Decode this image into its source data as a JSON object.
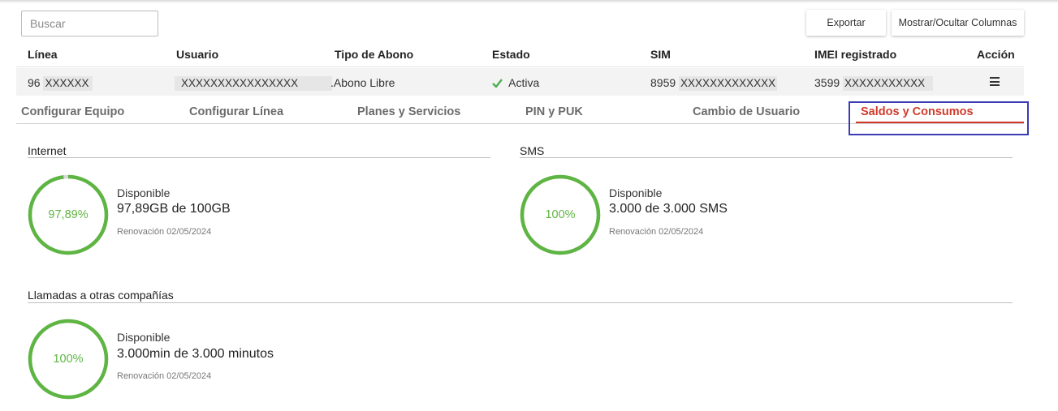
{
  "search": {
    "placeholder": "Buscar"
  },
  "toolbar": {
    "export_label": "Exportar",
    "columns_label": "Mostrar/Ocultar Columnas"
  },
  "table": {
    "headers": [
      "Línea",
      "Usuario",
      "Tipo de Abono",
      "Estado",
      "SIM",
      "IMEI registrado",
      "Acción"
    ],
    "row": {
      "line_prefix": "96",
      "line_masked": "XXXXXX",
      "user_masked": "XXXXXXXXXXXXXXXX",
      "plan": ".Abono Libre",
      "status": "Activa",
      "sim_prefix": "8959",
      "sim_masked": "XXXXXXXXXXXXX",
      "imei_prefix": "3599",
      "imei_masked": "XXXXXXXXXXX"
    }
  },
  "tabs": [
    {
      "label": "Configurar Equipo",
      "active": false
    },
    {
      "label": "Configurar Línea",
      "active": false
    },
    {
      "label": "Planes y Servicios",
      "active": false
    },
    {
      "label": "PIN y PUK",
      "active": false
    },
    {
      "label": "Cambio de Usuario",
      "active": false
    },
    {
      "label": "Saldos y Consumos",
      "active": true
    }
  ],
  "balances": [
    {
      "title": "Internet",
      "percent_label": "97,89%",
      "percent": 97.89,
      "available_label": "Disponible",
      "amount": "97,89GB de 100GB",
      "renewal": "Renovación 02/05/2024"
    },
    {
      "title": "SMS",
      "percent_label": "100%",
      "percent": 100,
      "available_label": "Disponible",
      "amount": "3.000 de 3.000 SMS",
      "renewal": "Renovación 02/05/2024"
    },
    {
      "title": "Llamadas a otras compañías",
      "percent_label": "100%",
      "percent": 100,
      "available_label": "Disponible",
      "amount": "3.000min de 3.000 minutos",
      "renewal": "Renovación 02/05/2024"
    }
  ],
  "colors": {
    "accent": "#d03a2b",
    "gauge": "#5fb543",
    "gauge_track": "#d9d9d9",
    "status_ok": "#4caf50"
  }
}
